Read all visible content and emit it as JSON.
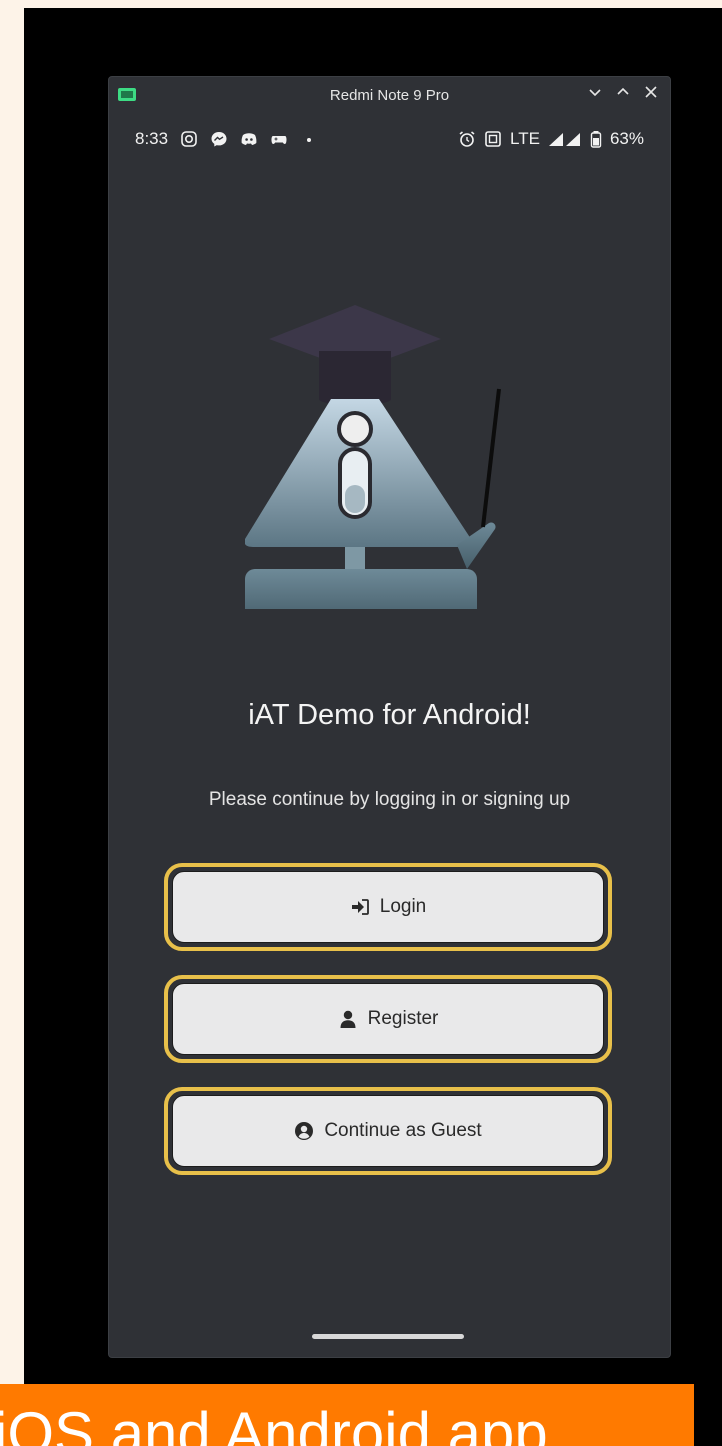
{
  "window": {
    "title": "Redmi Note 9 Pro",
    "controls": [
      "minimize-chevron-icon",
      "maximize-chevron-icon",
      "close-icon"
    ]
  },
  "statusbar": {
    "time": "8:33",
    "left_icons": [
      "instagram-icon",
      "messenger-icon",
      "discord-icon",
      "gamepad-icon",
      "dot-icon"
    ],
    "right_icons": [
      "alarm-icon",
      "nfc-icon",
      "signal-icon",
      "battery-icon"
    ],
    "network": "LTE",
    "battery": "63%"
  },
  "app": {
    "title": "iAT Demo for Android!",
    "subtitle": "Please continue by logging in or signing up"
  },
  "buttons": {
    "login": "Login",
    "register": "Register",
    "guest": "Continue as Guest"
  },
  "colors": {
    "highlight": "#e8c04a",
    "background": "#2f3136",
    "banner": "#ff7a00"
  },
  "banner": {
    "text": "iOS and Android app"
  }
}
